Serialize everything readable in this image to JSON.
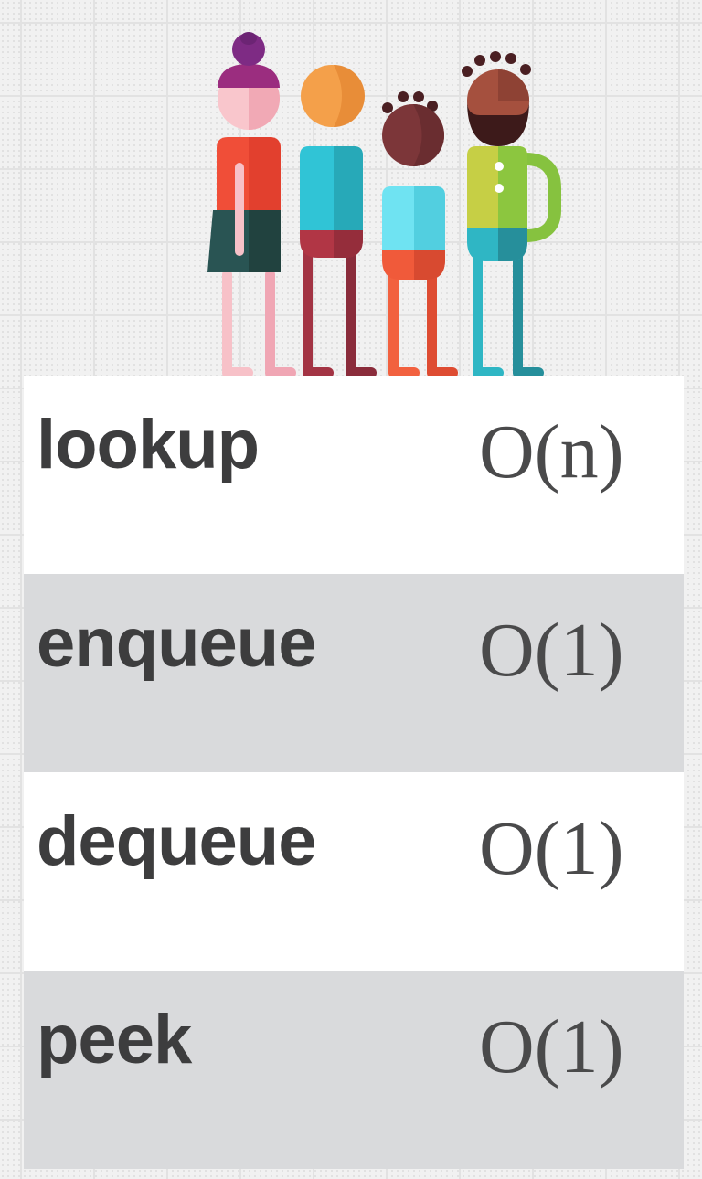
{
  "operations": [
    {
      "name": "lookup",
      "complexity": "O(n)"
    },
    {
      "name": "enqueue",
      "complexity": "O(1)"
    },
    {
      "name": "dequeue",
      "complexity": "O(1)"
    },
    {
      "name": "peek",
      "complexity": "O(1)"
    }
  ],
  "illustration": {
    "icon": "people-queue-icon",
    "count": 4
  }
}
